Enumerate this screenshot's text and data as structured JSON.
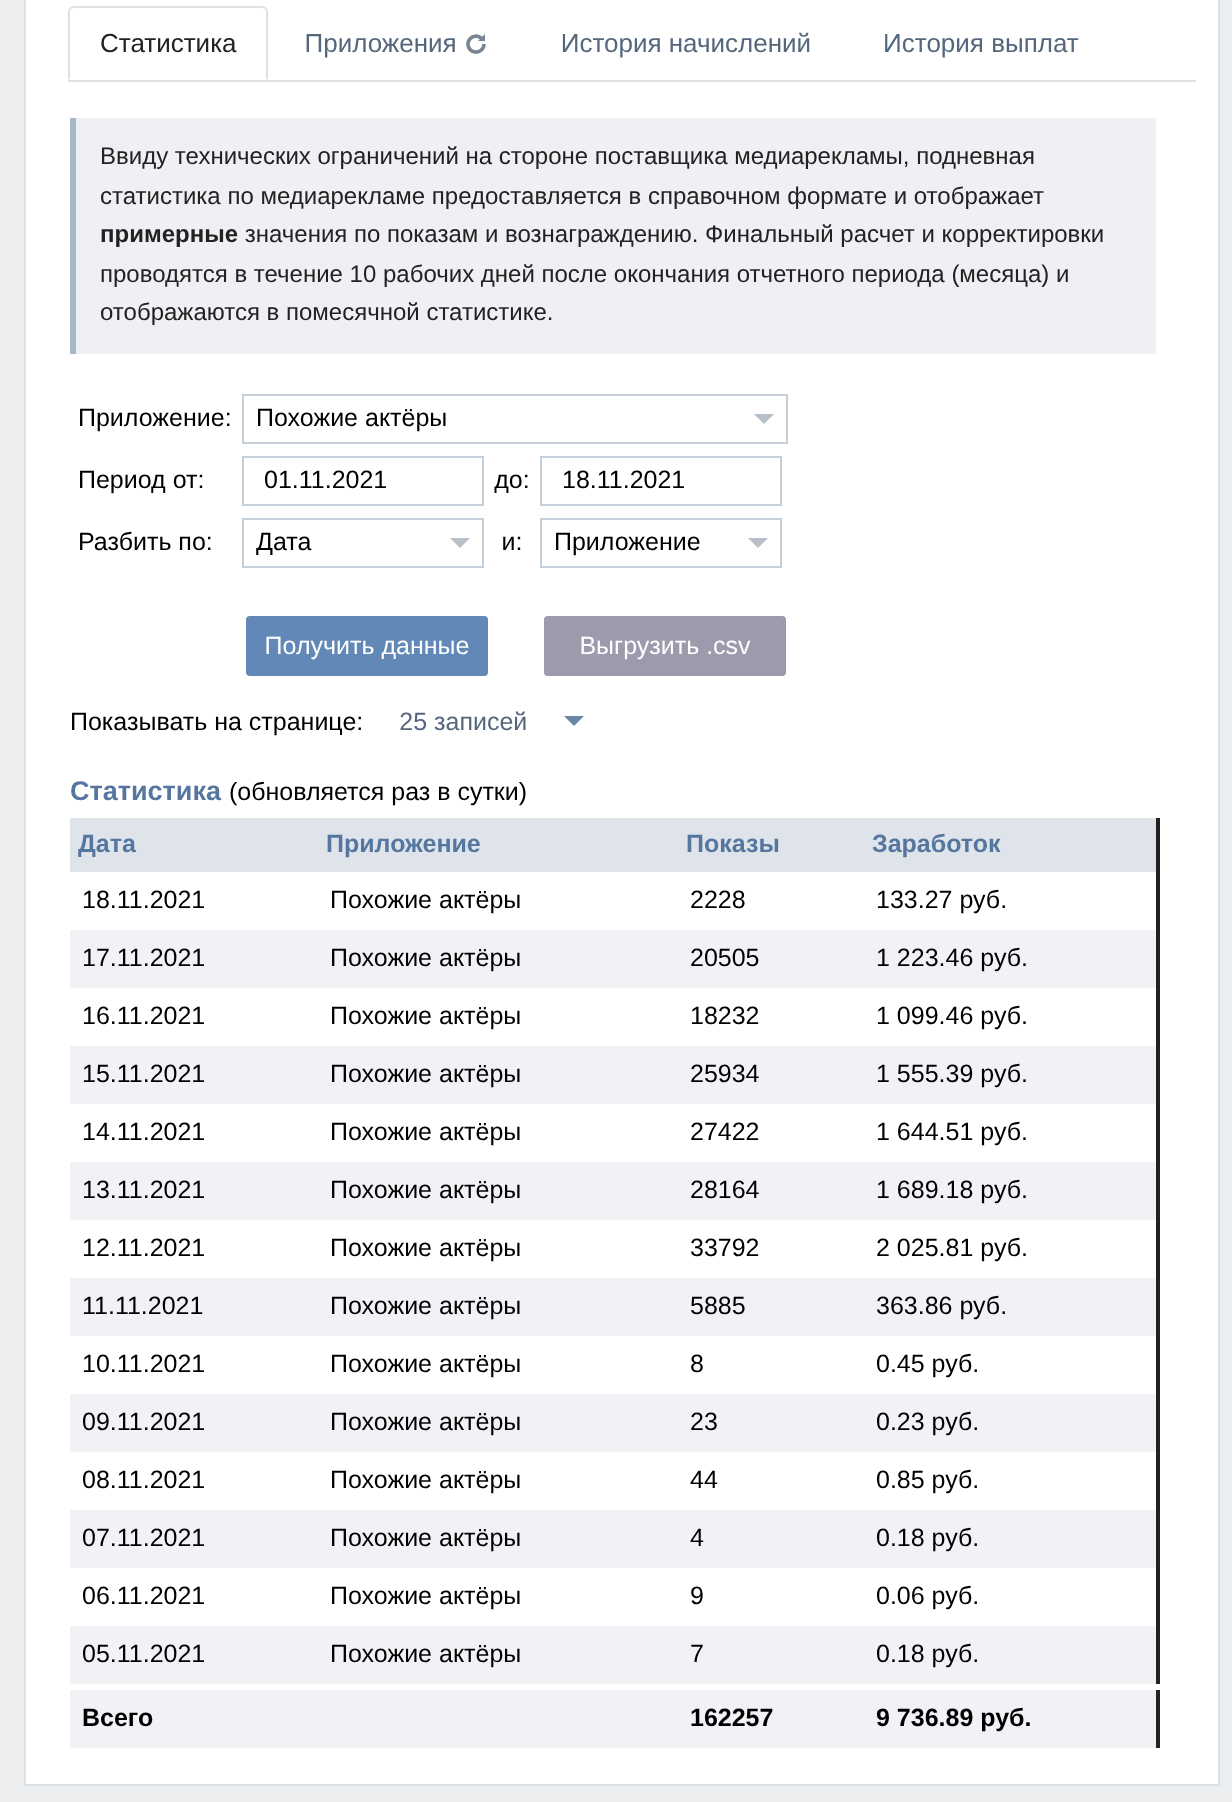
{
  "tabs": [
    {
      "label": "Статистика",
      "selected": true,
      "refresh": false
    },
    {
      "label": "Приложения",
      "selected": false,
      "refresh": true
    },
    {
      "label": "История начислений",
      "selected": false,
      "refresh": false
    },
    {
      "label": "История выплат",
      "selected": false,
      "refresh": false
    }
  ],
  "notice": "Ввиду технических ограничений на стороне поставщика медиарекламы, подневная статистика по медиарекламе предоставляется в справочном формате и отображает **примерные** значения по показам и вознаграждению. Финальный расчет и корректировки проводятся в течение 10 рабочих дней после окончания отчетного периода (месяца) и отображаются в помесячной статистике.",
  "form": {
    "app_label": "Приложение:",
    "app_value": "Похожие актёры",
    "period_label": "Период от:",
    "from": "01.11.2021",
    "to_label": "до:",
    "to": "18.11.2021",
    "split_label": "Разбить по:",
    "split_value": "Дата",
    "and_label": "и:",
    "and_value": "Приложение"
  },
  "buttons": [
    {
      "label": "Получить данные",
      "disabled": false
    },
    {
      "label": "Выгрузить .csv",
      "disabled": true
    }
  ],
  "per_page": {
    "label": "Показывать на странице:",
    "value": "25 записей"
  },
  "stats_title": "Статистика",
  "stats_note": "(обновляется раз в сутки)",
  "table": {
    "columns": [
      "Дата",
      "Приложение",
      "Показы",
      "Заработок"
    ],
    "rows": [
      [
        "18.11.2021",
        "Похожие актёры",
        "2228",
        "133.27 руб."
      ],
      [
        "17.11.2021",
        "Похожие актёры",
        "20505",
        "1 223.46 руб."
      ],
      [
        "16.11.2021",
        "Похожие актёры",
        "18232",
        "1 099.46 руб."
      ],
      [
        "15.11.2021",
        "Похожие актёры",
        "25934",
        "1 555.39 руб."
      ],
      [
        "14.11.2021",
        "Похожие актёры",
        "27422",
        "1 644.51 руб."
      ],
      [
        "13.11.2021",
        "Похожие актёры",
        "28164",
        "1 689.18 руб."
      ],
      [
        "12.11.2021",
        "Похожие актёры",
        "33792",
        "2 025.81 руб."
      ],
      [
        "11.11.2021",
        "Похожие актёры",
        "5885",
        "363.86 руб."
      ],
      [
        "10.11.2021",
        "Похожие актёры",
        "8",
        "0.45 руб."
      ],
      [
        "09.11.2021",
        "Похожие актёры",
        "23",
        "0.23 руб."
      ],
      [
        "08.11.2021",
        "Похожие актёры",
        "44",
        "0.85 руб."
      ],
      [
        "07.11.2021",
        "Похожие актёры",
        "4",
        "0.18 руб."
      ],
      [
        "06.11.2021",
        "Похожие актёры",
        "9",
        "0.06 руб."
      ],
      [
        "05.11.2021",
        "Похожие актёры",
        "7",
        "0.18 руб."
      ]
    ],
    "total": {
      "label": "Всего",
      "shows": "162257",
      "earnings": "9 736.89 руб."
    }
  }
}
